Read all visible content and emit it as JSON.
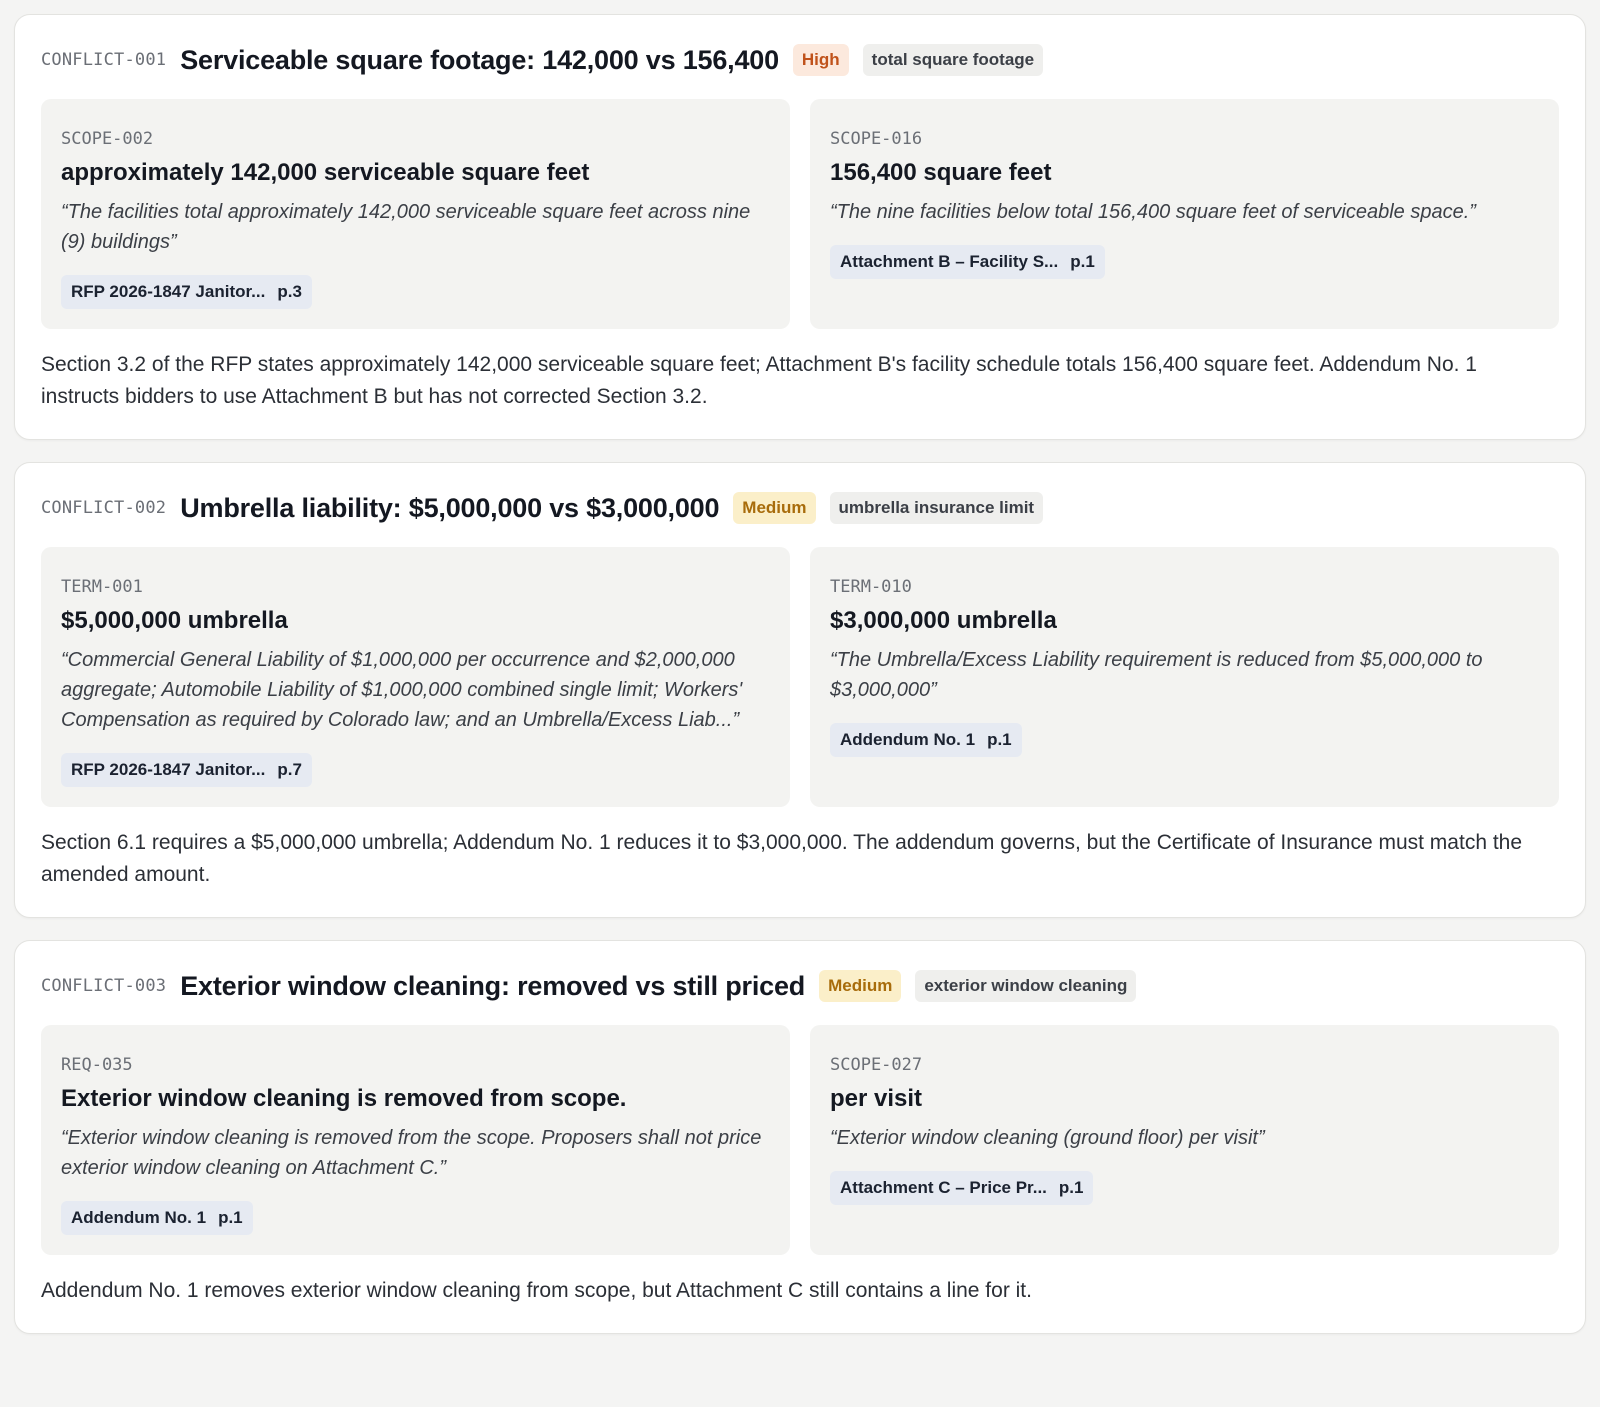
{
  "conflicts": [
    {
      "id": "CONFLICT-001",
      "title": "Serviceable square footage: 142,000 vs 156,400",
      "severity": "High",
      "topic": "total square footage",
      "left": {
        "id": "SCOPE-002",
        "value": "approximately 142,000 serviceable square feet",
        "quote": "“The facilities total approximately 142,000 serviceable square feet across nine (9) buildings”",
        "doc": "RFP 2026-1847 Janitor...",
        "page": "p.3"
      },
      "right": {
        "id": "SCOPE-016",
        "value": "156,400 square feet",
        "quote": "“The nine facilities below total 156,400 square feet of serviceable space.”",
        "doc": "Attachment B – Facility S...",
        "page": "p.1"
      },
      "note": "Section 3.2 of the RFP states approximately 142,000 serviceable square feet; Attachment B's facility schedule totals 156,400 square feet. Addendum No. 1 instructs bidders to use Attachment B but has not corrected Section 3.2."
    },
    {
      "id": "CONFLICT-002",
      "title": "Umbrella liability: $5,000,000 vs $3,000,000",
      "severity": "Medium",
      "topic": "umbrella insurance limit",
      "left": {
        "id": "TERM-001",
        "value": "$5,000,000 umbrella",
        "quote": "“Commercial General Liability of $1,000,000 per occurrence and $2,000,000 aggregate; Automobile Liability of $1,000,000 combined single limit; Workers' Compensation as required by Colorado law; and an Umbrella/Excess Liab...”",
        "doc": "RFP 2026-1847 Janitor...",
        "page": "p.7"
      },
      "right": {
        "id": "TERM-010",
        "value": "$3,000,000 umbrella",
        "quote": "“The Umbrella/Excess Liability requirement is reduced from $5,000,000 to $3,000,000”",
        "doc": "Addendum No. 1",
        "page": "p.1"
      },
      "note": "Section 6.1 requires a $5,000,000 umbrella; Addendum No. 1 reduces it to $3,000,000. The addendum governs, but the Certificate of Insurance must match the amended amount."
    },
    {
      "id": "CONFLICT-003",
      "title": "Exterior window cleaning: removed vs still priced",
      "severity": "Medium",
      "topic": "exterior window cleaning",
      "left": {
        "id": "REQ-035",
        "value": "Exterior window cleaning is removed from scope.",
        "quote": "“Exterior window cleaning is removed from the scope. Proposers shall not price exterior window cleaning on Attachment C.”",
        "doc": "Addendum No. 1",
        "page": "p.1"
      },
      "right": {
        "id": "SCOPE-027",
        "value": "per visit",
        "quote": "“Exterior window cleaning (ground floor) per visit”",
        "doc": "Attachment C – Price Pr...",
        "page": "p.1"
      },
      "note": "Addendum No. 1 removes exterior window cleaning from scope, but Attachment C still contains a line for it."
    }
  ]
}
